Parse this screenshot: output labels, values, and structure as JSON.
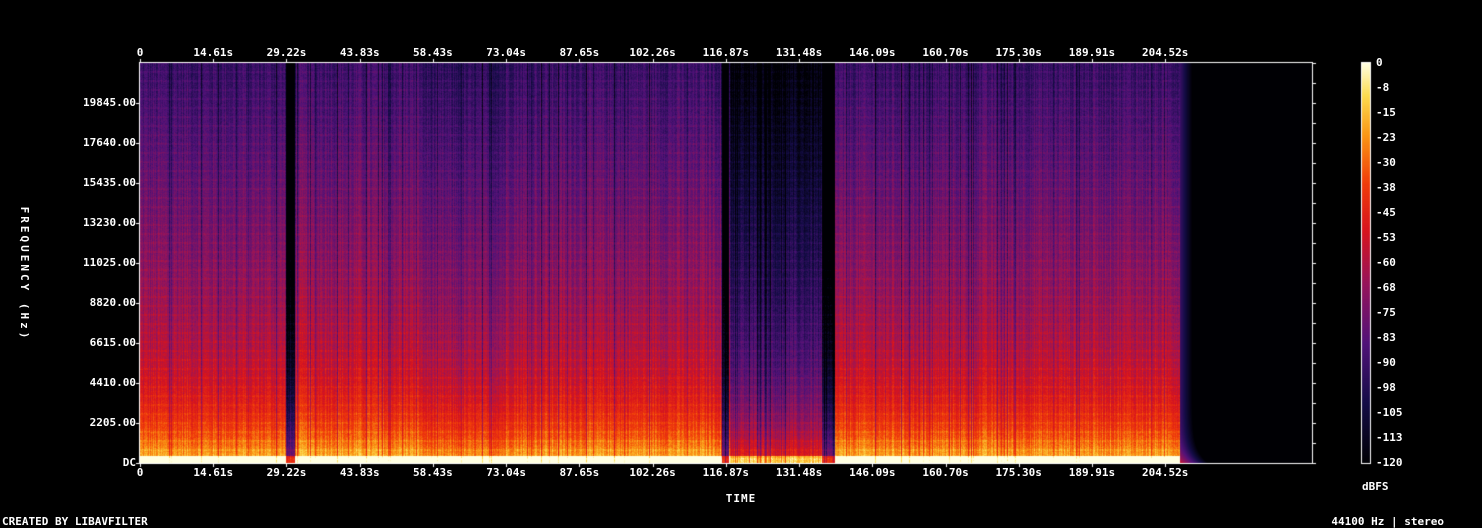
{
  "chart_data": {
    "type": "heatmap",
    "xlabel": "TIME",
    "ylabel": "FREQUENCY (Hz)",
    "x_ticks": [
      "0",
      "14.61s",
      "29.22s",
      "43.83s",
      "58.43s",
      "73.04s",
      "87.65s",
      "102.26s",
      "116.87s",
      "131.48s",
      "146.09s",
      "160.70s",
      "175.30s",
      "189.91s",
      "204.52s"
    ],
    "x_tick_values": [
      0,
      14.61,
      29.22,
      43.83,
      58.43,
      73.04,
      87.65,
      102.26,
      116.87,
      131.48,
      146.09,
      160.7,
      175.3,
      189.91,
      204.52
    ],
    "y_ticks": [
      "DC",
      "2205.00",
      "4410.00",
      "6615.00",
      "8820.00",
      "11025.00",
      "13230.00",
      "15435.00",
      "17640.00",
      "19845.00"
    ],
    "y_tick_values": [
      0,
      2205,
      4410,
      6615,
      8820,
      11025,
      13230,
      15435,
      17640,
      19845
    ],
    "xlim": [
      0,
      233.8
    ],
    "ylim": [
      0,
      22050
    ],
    "colorbar": {
      "label": "dBFS",
      "ticks": [
        "0",
        "-8",
        "-15",
        "-23",
        "-30",
        "-38",
        "-45",
        "-53",
        "-60",
        "-68",
        "-75",
        "-83",
        "-90",
        "-98",
        "-105",
        "-113",
        "-120"
      ],
      "range": [
        -120,
        0
      ]
    },
    "audio_end_s": 207.3,
    "quiet_segments_s": [
      [
        29.0,
        30.8
      ],
      [
        116.0,
        117.3
      ],
      [
        136.0,
        138.5
      ]
    ],
    "sections": [
      {
        "start": 0,
        "end": 29,
        "level_db": -50
      },
      {
        "start": 31,
        "end": 56,
        "level_db": -48
      },
      {
        "start": 56,
        "end": 73,
        "level_db": -55
      },
      {
        "start": 73,
        "end": 116,
        "level_db": -50
      },
      {
        "start": 117.5,
        "end": 137,
        "level_db": -78
      },
      {
        "start": 138.5,
        "end": 207.3,
        "level_db": -50
      }
    ]
  },
  "footer": {
    "credit": "CREATED BY LIBAVFILTER",
    "sample_rate": "44100 Hz | stereo"
  }
}
